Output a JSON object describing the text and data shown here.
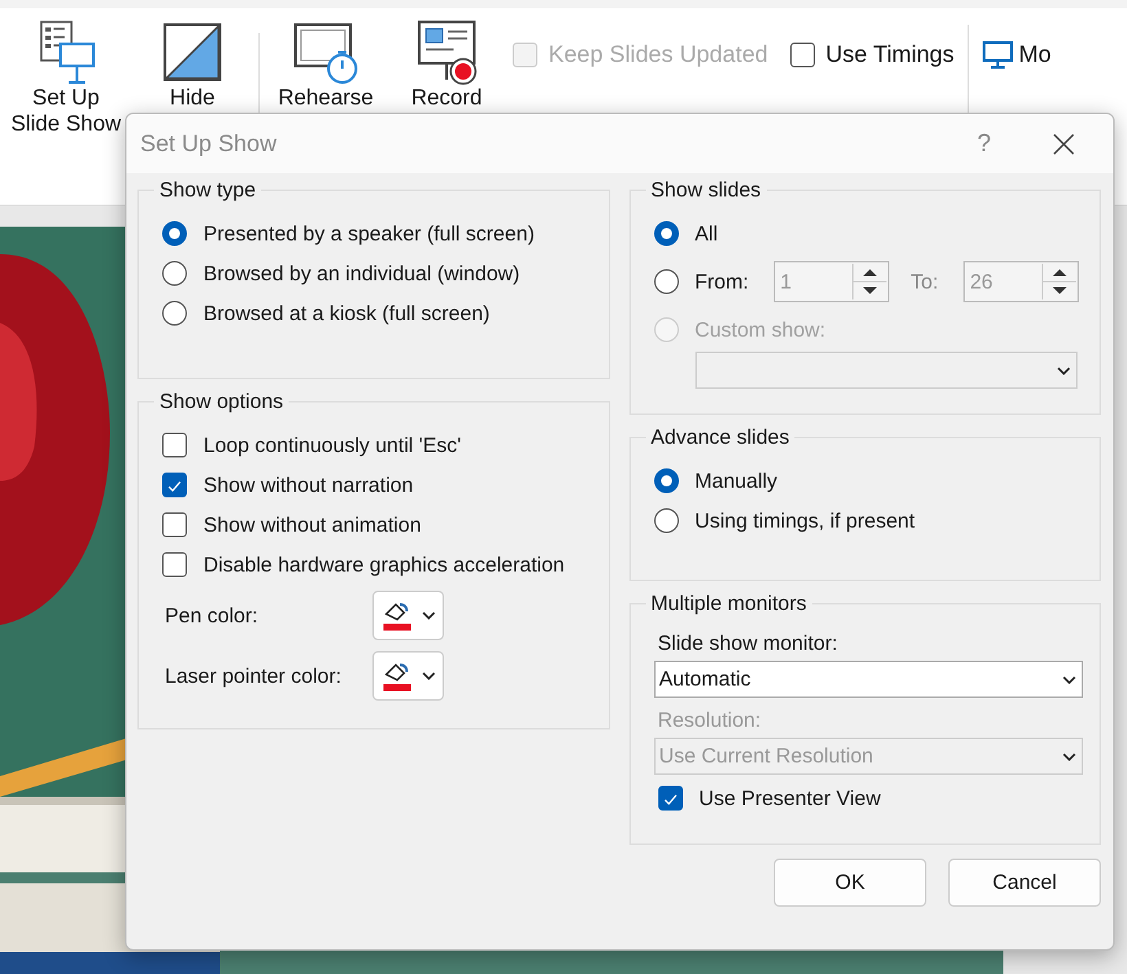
{
  "ribbon": {
    "commands": [
      {
        "kind": "setup",
        "lines": [
          "Set Up",
          "Slide Show"
        ]
      },
      {
        "kind": "hide",
        "lines": [
          "Hide"
        ]
      },
      {
        "kind": "rehearse",
        "lines": [
          "Rehearse"
        ]
      },
      {
        "kind": "record",
        "lines": [
          "Record"
        ]
      }
    ],
    "checkboxes": [
      {
        "label": "Keep Slides Updated",
        "checked": false,
        "disabled": true
      },
      {
        "label": "Use Timings",
        "checked": false,
        "disabled": false
      }
    ],
    "monitor": {
      "label": "Mo"
    }
  },
  "dialog": {
    "title": "Set Up Show",
    "help": "?",
    "show_type": {
      "title": "Show type",
      "options": [
        {
          "label": "Presented by a speaker (full screen)",
          "selected": true
        },
        {
          "label": "Browsed by an individual (window)",
          "selected": false
        },
        {
          "label": "Browsed at a kiosk (full screen)",
          "selected": false
        }
      ]
    },
    "show_options": {
      "title": "Show options",
      "checks": [
        {
          "label": "Loop continuously until 'Esc'",
          "checked": false
        },
        {
          "label": "Show without narration",
          "checked": true
        },
        {
          "label": "Show without animation",
          "checked": false
        },
        {
          "label": "Disable hardware graphics acceleration",
          "checked": false
        }
      ],
      "colors": [
        {
          "label": "Pen color:",
          "color": "#e81123"
        },
        {
          "label": "Laser pointer color:",
          "color": "#e81123"
        }
      ]
    },
    "show_slides": {
      "title": "Show slides",
      "options": [
        {
          "kind": "plain",
          "label": "All",
          "selected": true,
          "disabled": false
        },
        {
          "kind": "range",
          "label": "From:",
          "selected": false,
          "disabled": false
        },
        {
          "kind": "custom",
          "label": "Custom show:",
          "selected": false,
          "disabled": true
        }
      ],
      "from": {
        "value": "1",
        "disabled": true
      },
      "to_label": "To:",
      "to": {
        "value": "26",
        "disabled": true
      },
      "custom_dropdown": {
        "disabled": true
      }
    },
    "advance": {
      "title": "Advance slides",
      "options": [
        {
          "label": "Manually",
          "selected": true
        },
        {
          "label": "Using timings, if present",
          "selected": false
        }
      ]
    },
    "monitors": {
      "title": "Multiple monitors",
      "monitor_label": "Slide show monitor:",
      "monitor_value": "Automatic",
      "resolution_label": "Resolution:",
      "resolution_value": "Use Current Resolution",
      "resolution_disabled": true,
      "presenter_view": {
        "label": "Use Presenter View",
        "checked": true
      }
    },
    "buttons": [
      "OK",
      "Cancel"
    ]
  }
}
